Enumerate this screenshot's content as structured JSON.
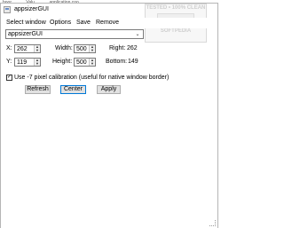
{
  "background": {
    "strip_items": [
      "boor",
      "Valu",
      "application coo..."
    ]
  },
  "window": {
    "title": "appsizerGUI"
  },
  "watermark": {
    "line1": "TESTED • 100% CLEAN",
    "line2": "SOFTPEDIA"
  },
  "menu": {
    "items": [
      "Select window",
      "Options",
      "Save",
      "Remove"
    ]
  },
  "window_select": {
    "value": "appsizerGUI",
    "arrow": "⌄"
  },
  "position": {
    "x_label": "X:",
    "x_value": "262",
    "y_label": "Y:",
    "y_value": "119",
    "width_label": "Width:",
    "width_value": "500",
    "height_label": "Height:",
    "height_value": "500",
    "right_label": "Right:",
    "right_value": "262",
    "bottom_label": "Bottom:",
    "bottom_value": "149"
  },
  "calibration": {
    "checked": true,
    "label": "Use -7 pixel calibration (useful for native window border)"
  },
  "buttons": {
    "refresh": "Refresh",
    "center": "Center",
    "apply": "Apply"
  },
  "colors": {
    "accent": "#0078d7",
    "button_face": "#e1e1e1"
  }
}
